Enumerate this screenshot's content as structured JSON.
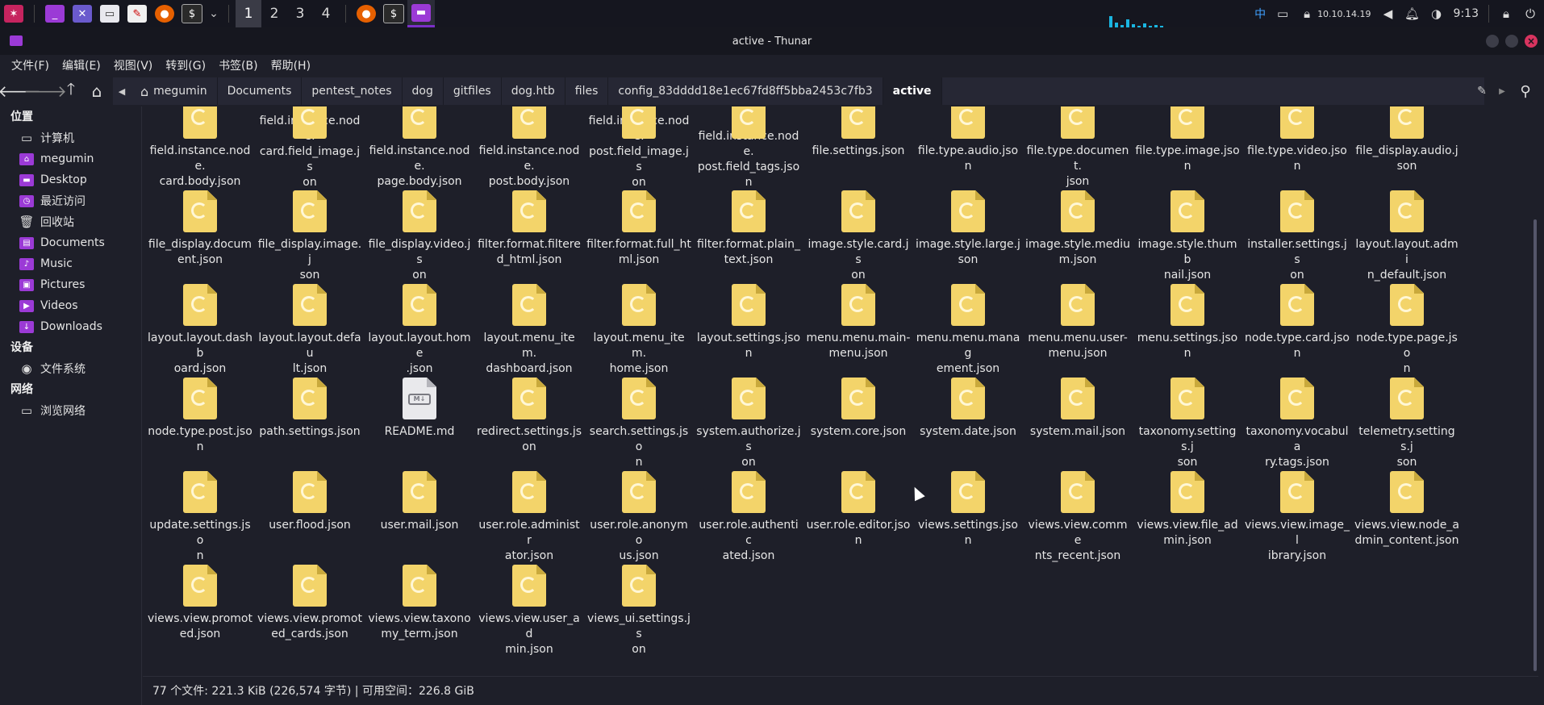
{
  "taskbar": {
    "apps": [
      {
        "name": "kali-menu-icon",
        "color": "#c6245f"
      },
      {
        "name": "terminal-icon",
        "color": "#9b3ad6",
        "glyph": "_"
      },
      {
        "name": "desktop-icon",
        "color": "#6a5acd",
        "glyph": "✕"
      },
      {
        "name": "file-manager-icon",
        "color": "#e8e8ee",
        "glyph": "▭"
      },
      {
        "name": "text-editor-icon",
        "color": "#f0f0f0",
        "glyph": "✎"
      },
      {
        "name": "firefox-icon",
        "color": "#e66000",
        "glyph": "●"
      },
      {
        "name": "terminal-icon",
        "color": "#2a2a2a",
        "glyph": "$"
      }
    ],
    "workspaces": [
      "1",
      "2",
      "3",
      "4"
    ],
    "active_workspace": "1",
    "tray": {
      "ime": "中",
      "ip": "10.10.14.19",
      "time": "9:13"
    }
  },
  "window": {
    "title": "active - Thunar"
  },
  "menubar": [
    "文件(F)",
    "编辑(E)",
    "视图(V)",
    "转到(G)",
    "书签(B)",
    "帮助(H)"
  ],
  "breadcrumbs": [
    "megumin",
    "Documents",
    "pentest_notes",
    "dog",
    "gitfiles",
    "dog.htb",
    "files",
    "config_83dddd18e1ec67fd8ff5bba2453c7fb3",
    "active"
  ],
  "sidebar": {
    "sections": [
      {
        "title": "位置",
        "items": [
          {
            "label": "计算机",
            "icon": "computer-icon"
          },
          {
            "label": "megumin",
            "icon": "home-folder-icon"
          },
          {
            "label": "Desktop",
            "icon": "desktop-folder-icon"
          },
          {
            "label": "最近访问",
            "icon": "recent-icon"
          },
          {
            "label": "回收站",
            "icon": "trash-icon"
          },
          {
            "label": "Documents",
            "icon": "documents-folder-icon"
          },
          {
            "label": "Music",
            "icon": "music-folder-icon"
          },
          {
            "label": "Pictures",
            "icon": "pictures-folder-icon"
          },
          {
            "label": "Videos",
            "icon": "videos-folder-icon"
          },
          {
            "label": "Downloads",
            "icon": "downloads-folder-icon"
          }
        ]
      },
      {
        "title": "设备",
        "items": [
          {
            "label": "文件系统",
            "icon": "filesystem-icon"
          }
        ]
      },
      {
        "title": "网络",
        "items": [
          {
            "label": "浏览网络",
            "icon": "network-icon"
          }
        ]
      }
    ]
  },
  "files": [
    "field.instance.node.card.body.json",
    "field.instance.node.card.field_image.json",
    "field.instance.node.page.body.json",
    "field.instance.node.post.body.json",
    "field.instance.node.post.field_image.json",
    "field.instance.node.post.field_tags.json",
    "file.settings.json",
    "file.type.audio.json",
    "file.type.document.json",
    "file.type.image.json",
    "file.type.video.json",
    "file_display.audio.json",
    "file_display.document.json",
    "file_display.image.json",
    "file_display.video.json",
    "filter.format.filtered_html.json",
    "filter.format.full_html.json",
    "filter.format.plain_text.json",
    "image.style.card.json",
    "image.style.large.json",
    "image.style.medium.json",
    "image.style.thumbnail.json",
    "installer.settings.json",
    "layout.layout.admin_default.json",
    "layout.layout.dashboard.json",
    "layout.layout.default.json",
    "layout.layout.home.json",
    "layout.menu_item.dashboard.json",
    "layout.menu_item.home.json",
    "layout.settings.json",
    "menu.menu.main-menu.json",
    "menu.menu.management.json",
    "menu.menu.user-menu.json",
    "menu.settings.json",
    "node.type.card.json",
    "node.type.page.json",
    "node.type.post.json",
    "path.settings.json",
    "README.md",
    "redirect.settings.json",
    "search.settings.json",
    "system.authorize.json",
    "system.core.json",
    "system.date.json",
    "system.mail.json",
    "taxonomy.settings.json",
    "taxonomy.vocabulary.tags.json",
    "telemetry.settings.json",
    "update.settings.json",
    "user.flood.json",
    "user.mail.json",
    "user.role.administrator.json",
    "user.role.anonymous.json",
    "user.role.authenticated.json",
    "user.role.editor.json",
    "views.settings.json",
    "views.view.comments_recent.json",
    "views.view.file_admin.json",
    "views.view.image_library.json",
    "views.view.node_admin_content.json",
    "views.view.promoted.json",
    "views.view.promoted_cards.json",
    "views.view.taxonomy_term.json",
    "views.view.user_admin.json",
    "views_ui.settings.json"
  ],
  "files_display": [
    [
      "field.instance.node.",
      "card.body.json"
    ],
    [
      "field.instance.node.",
      "card.field_image.js",
      "on"
    ],
    [
      "field.instance.node.",
      "page.body.json"
    ],
    [
      "field.instance.node.",
      "post.body.json"
    ],
    [
      "field.instance.node.",
      "post.field_image.js",
      "on"
    ],
    [
      "field.instance.node.",
      "post.field_tags.json"
    ],
    [
      "file.settings.json"
    ],
    [
      "file.type.audio.json"
    ],
    [
      "file.type.document.",
      "json"
    ],
    [
      "file.type.image.jso",
      "n"
    ],
    [
      "file.type.video.json"
    ],
    [
      "file_display.audio.j",
      "son"
    ],
    [
      "file_display.docum",
      "ent.json"
    ],
    [
      "file_display.image.j",
      "son"
    ],
    [
      "file_display.video.js",
      "on"
    ],
    [
      "filter.format.filtere",
      "d_html.json"
    ],
    [
      "filter.format.full_ht",
      "ml.json"
    ],
    [
      "filter.format.plain_",
      "text.json"
    ],
    [
      "image.style.card.js",
      "on"
    ],
    [
      "image.style.large.j",
      "son"
    ],
    [
      "image.style.mediu",
      "m.json"
    ],
    [
      "image.style.thumb",
      "nail.json"
    ],
    [
      "installer.settings.js",
      "on"
    ],
    [
      "layout.layout.admi",
      "n_default.json"
    ],
    [
      "layout.layout.dashb",
      "oard.json"
    ],
    [
      "layout.layout.defau",
      "lt.json"
    ],
    [
      "layout.layout.home",
      ".json"
    ],
    [
      "layout.menu_item.",
      "dashboard.json"
    ],
    [
      "layout.menu_item.",
      "home.json"
    ],
    [
      "layout.settings.json"
    ],
    [
      "menu.menu.main-",
      "menu.json"
    ],
    [
      "menu.menu.manag",
      "ement.json"
    ],
    [
      "menu.menu.user-",
      "menu.json"
    ],
    [
      "menu.settings.json"
    ],
    [
      "node.type.card.json"
    ],
    [
      "node.type.page.jso",
      "n"
    ],
    [
      "node.type.post.json"
    ],
    [
      "path.settings.json"
    ],
    [
      "README.md"
    ],
    [
      "redirect.settings.js",
      "on"
    ],
    [
      "search.settings.jso",
      "n"
    ],
    [
      "system.authorize.js",
      "on"
    ],
    [
      "system.core.json"
    ],
    [
      "system.date.json"
    ],
    [
      "system.mail.json"
    ],
    [
      "taxonomy.settings.j",
      "son"
    ],
    [
      "taxonomy.vocabula",
      "ry.tags.json"
    ],
    [
      "telemetry.settings.j",
      "son"
    ],
    [
      "update.settings.jso",
      "n"
    ],
    [
      "user.flood.json"
    ],
    [
      "user.mail.json"
    ],
    [
      "user.role.administr",
      "ator.json"
    ],
    [
      "user.role.anonymo",
      "us.json"
    ],
    [
      "user.role.authentic",
      "ated.json"
    ],
    [
      "user.role.editor.jso",
      "n"
    ],
    [
      "views.settings.json"
    ],
    [
      "views.view.comme",
      "nts_recent.json"
    ],
    [
      "views.view.file_ad",
      "min.json"
    ],
    [
      "views.view.image_l",
      "ibrary.json"
    ],
    [
      "views.view.node_a",
      "dmin_content.json"
    ],
    [
      "views.view.promot",
      "ed.json"
    ],
    [
      "views.view.promot",
      "ed_cards.json"
    ],
    [
      "views.view.taxono",
      "my_term.json"
    ],
    [
      "views.view.user_ad",
      "min.json"
    ],
    [
      "views_ui.settings.js",
      "on"
    ]
  ],
  "statusbar": {
    "text": "77 个文件: 221.3 KiB (226,574 字节) | 可用空间：226.8 GiB"
  },
  "colors": {
    "accent": "#9b3ad6",
    "file_icon": "#f3d46a",
    "close_button": "#d8345f",
    "background": "#1e1f29"
  }
}
